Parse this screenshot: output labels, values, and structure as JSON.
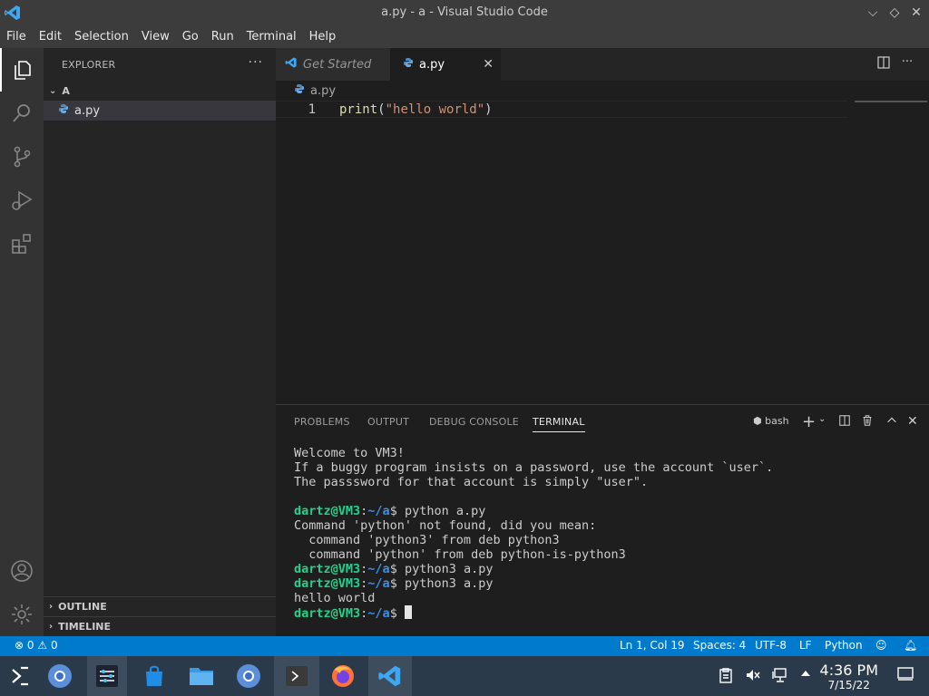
{
  "window": {
    "title": "a.py - a - Visual Studio Code"
  },
  "menu": [
    "File",
    "Edit",
    "Selection",
    "View",
    "Go",
    "Run",
    "Terminal",
    "Help"
  ],
  "sidebar": {
    "header": "EXPLORER",
    "more": "···",
    "folder": "A",
    "files": [
      "a.py"
    ],
    "sections": [
      "OUTLINE",
      "TIMELINE"
    ]
  },
  "tabs": [
    {
      "label": "Get Started",
      "active": false
    },
    {
      "label": "a.py",
      "active": true,
      "close": "✕"
    }
  ],
  "breadcrumb": "a.py",
  "editor": {
    "lines": [
      {
        "number": "1",
        "tokens": {
          "fn": "print",
          "open": "(",
          "str": "\"hello world\"",
          "close": ")"
        }
      }
    ]
  },
  "panel": {
    "tabs": [
      "PROBLEMS",
      "OUTPUT",
      "DEBUG CONSOLE",
      "TERMINAL"
    ],
    "active_tab": "TERMINAL",
    "shell": "bash",
    "terminal": {
      "welcome": [
        "Welcome to VM3!",
        "If a buggy program insists on a password, use the account `user`.",
        "The passsword for that account is simply \"user\"."
      ],
      "prompt_user": "dartz@VM3",
      "prompt_path": "~/a",
      "commands": [
        {
          "cmd": "python a.py",
          "output": [
            "Command 'python' not found, did you mean:",
            "  command 'python3' from deb python3",
            "  command 'python' from deb python-is-python3"
          ]
        },
        {
          "cmd": "python3 a.py",
          "output": []
        },
        {
          "cmd": "python3 a.py",
          "output": [
            "hello world"
          ]
        }
      ]
    }
  },
  "status": {
    "errors": "0",
    "warnings": "0",
    "position": "Ln 1, Col 19",
    "spaces": "Spaces: 4",
    "encoding": "UTF-8",
    "eol": "LF",
    "language": "Python"
  },
  "taskbar": {
    "time": "4:36 PM",
    "date": "7/15/22"
  },
  "colors": {
    "accent": "#007acc",
    "activity_bar": "#333333",
    "sidebar": "#252526",
    "editor": "#1e1e1e"
  }
}
